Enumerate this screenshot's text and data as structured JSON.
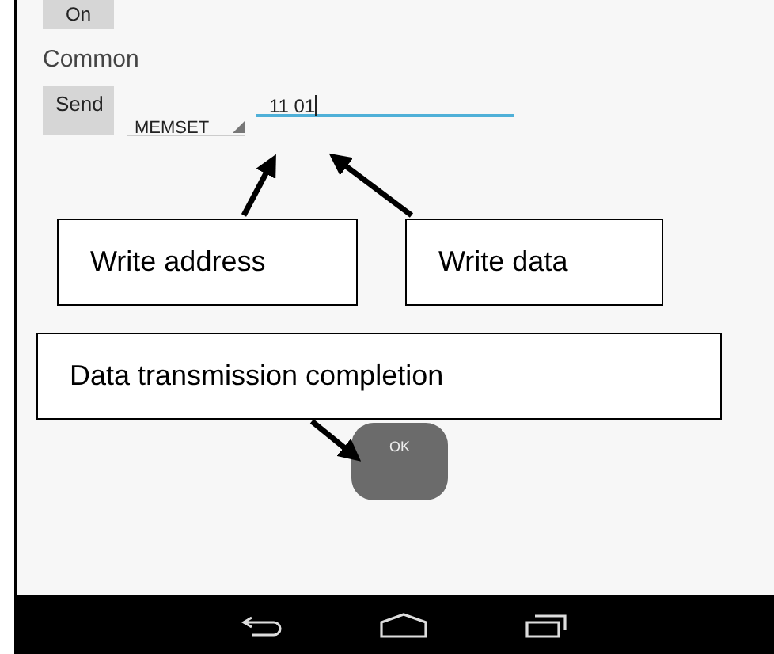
{
  "top_button": "On",
  "section_title": "Common",
  "send_button": "Send",
  "spinner": {
    "value": "MEMSET"
  },
  "data_field": {
    "value": "11 01",
    "focused": true
  },
  "ok_button": "OK",
  "callouts": [
    {
      "text": "Write address"
    },
    {
      "text": "Write data"
    },
    {
      "text": "Data transmission completion"
    }
  ]
}
